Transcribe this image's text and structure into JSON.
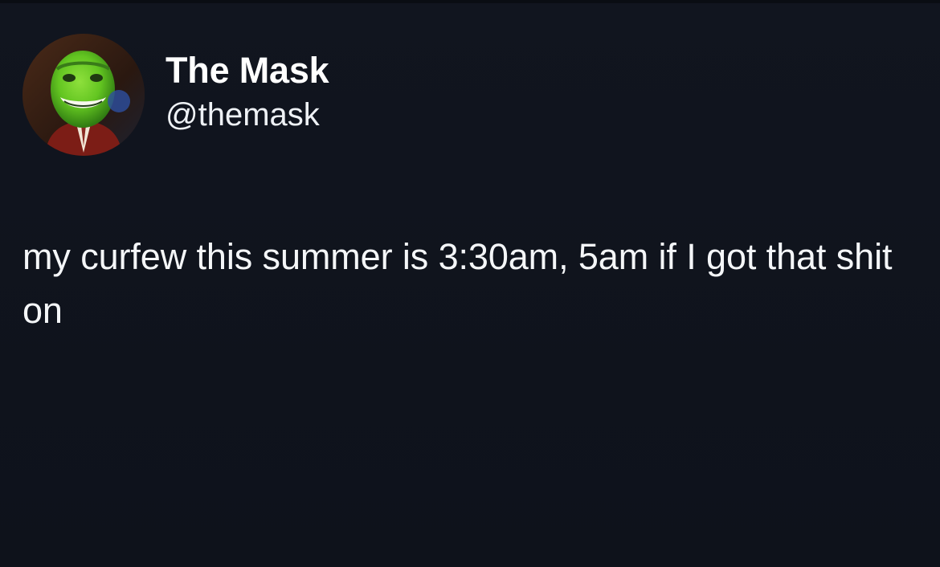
{
  "profile": {
    "display_name": "The Mask",
    "handle": "@themask",
    "avatar_icon": "green-mask-avatar"
  },
  "tweet": {
    "text": "my curfew this summer is 3:30am, 5am if I got that shit on"
  },
  "colors": {
    "background": "#0f131c",
    "text": "#f4f6f8",
    "avatar_face": "#6ecb2c"
  }
}
